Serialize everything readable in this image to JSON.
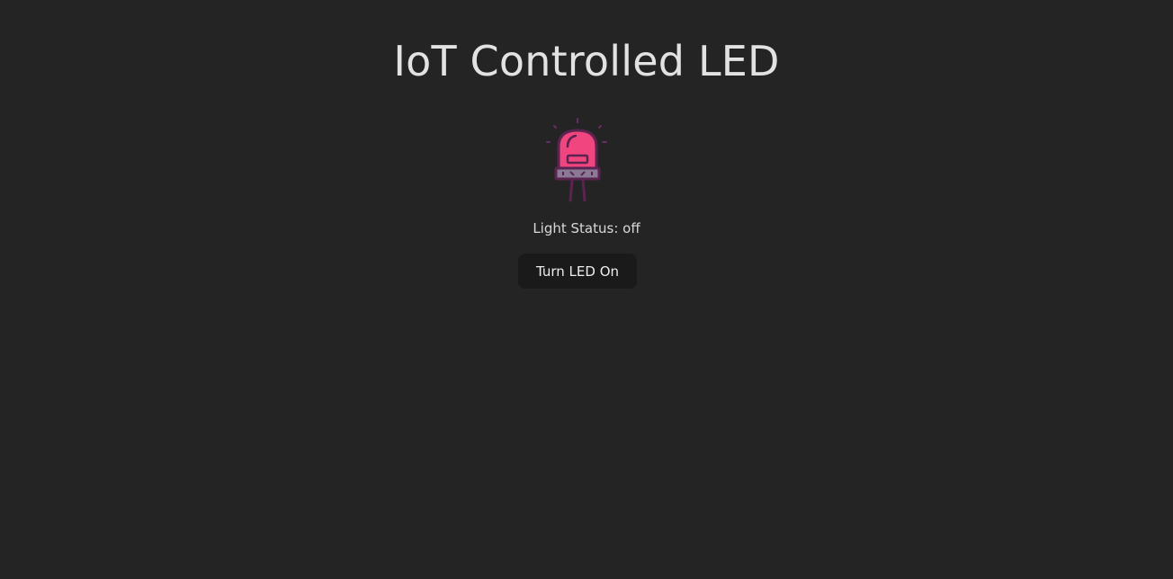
{
  "header": {
    "title": "IoT Controlled LED"
  },
  "led": {
    "icon": "led-bulb-icon",
    "state": "off",
    "colors": {
      "bulb": "#f0457e",
      "outline": "#5a2350",
      "base": "#8a7a96",
      "rays": "#6a2a68"
    }
  },
  "status": {
    "text": "Light Status: off"
  },
  "controls": {
    "toggle_label": "Turn LED On"
  }
}
